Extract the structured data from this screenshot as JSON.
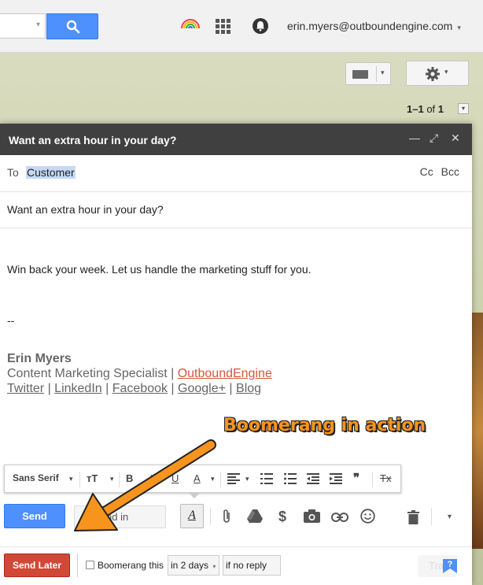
{
  "header": {
    "search_caret": "▾",
    "account_email": "erin.myers@outboundengine.com",
    "account_dropdown": "▾"
  },
  "toolbar": {
    "keyboard_caret": "▾",
    "settings_caret": "▾",
    "pager_range": "1–1",
    "pager_of": "of",
    "pager_total": "1"
  },
  "compose": {
    "title": "Want an extra hour in your day?",
    "minimize": "—",
    "expand": "⤢",
    "close": "✕",
    "to_label": "To",
    "recipient": "Customer",
    "cc_bcc": "Cc Bcc",
    "subject": "Want an extra hour in your day?",
    "body_line": "Win back your week. Let us handle the marketing stuff for you.",
    "sig_separator": "--",
    "sig_name": "Erin Myers",
    "sig_title": "Content Marketing Specialist | ",
    "sig_company": "OutboundEngine",
    "sig_links": [
      "Twitter",
      "LinkedIn",
      "Facebook",
      "Google+",
      "Blog"
    ],
    "sig_link_sep": " | "
  },
  "format_bar": {
    "font": "Sans Serif",
    "caret": "▾",
    "size": "тT",
    "bold": "B",
    "italic": "I",
    "underline": "U",
    "text_color": "A",
    "quote": "❞",
    "clear": "Tx"
  },
  "actions": {
    "send": "Send",
    "send_in": "nd in",
    "format_toggle": "A",
    "dollar": "$",
    "more_caret": "▾"
  },
  "boomerang": {
    "send_later": "Send Later",
    "boomerang_this": "Boomerang this",
    "when": "in 2 days",
    "when_caret": "▾",
    "condition": "if no reply",
    "trash_hint": "Tra"
  },
  "annotation": {
    "text": "Boomerang in action",
    "color": "#f7941d"
  }
}
